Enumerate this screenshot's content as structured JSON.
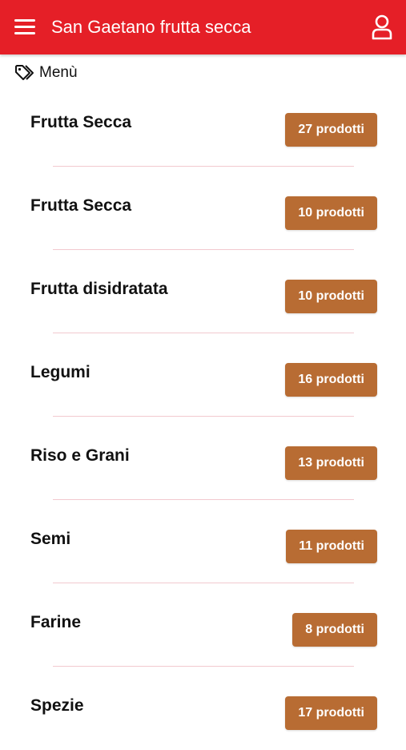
{
  "header": {
    "title": "San Gaetano frutta secca",
    "menu_icon": "hamburger-menu-icon",
    "user_icon": "user-account-icon",
    "background_color": "#e51f27"
  },
  "section": {
    "icon": "tag-icon",
    "label": "Menù"
  },
  "categories": [
    {
      "name": "Frutta Secca",
      "count_label": "27 prodotti"
    },
    {
      "name": "Frutta Secca",
      "count_label": "10 prodotti"
    },
    {
      "name": "Frutta disidratata",
      "count_label": "10 prodotti"
    },
    {
      "name": "Legumi",
      "count_label": "16 prodotti"
    },
    {
      "name": "Riso e Grani",
      "count_label": "13 prodotti"
    },
    {
      "name": "Semi",
      "count_label": "11 prodotti"
    },
    {
      "name": "Farine",
      "count_label": "8 prodotti"
    },
    {
      "name": "Spezie",
      "count_label": "17 prodotti"
    }
  ],
  "colors": {
    "badge": "#b86c33",
    "divider": "#f2c9cf"
  }
}
